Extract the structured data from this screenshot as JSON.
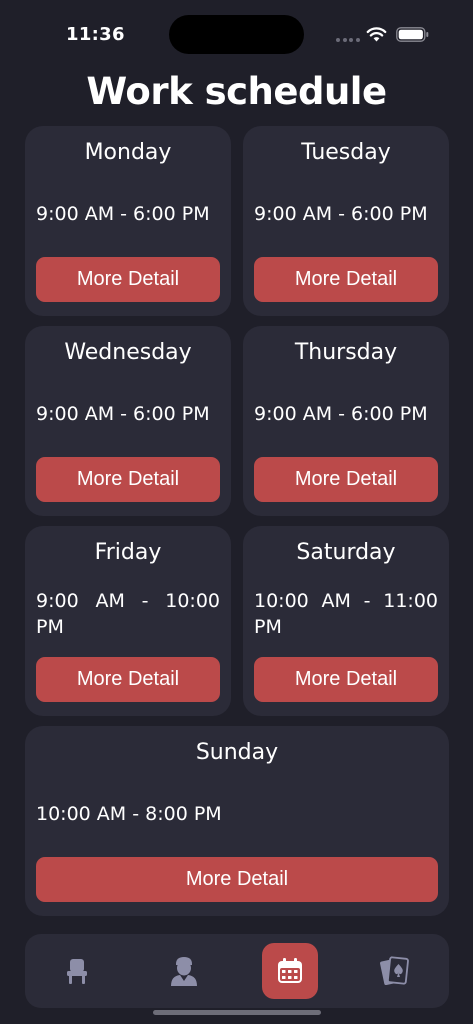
{
  "status_bar": {
    "time": "11:36"
  },
  "title": "Work schedule",
  "days": [
    {
      "name": "Monday",
      "hours": "9:00 AM - 6:00 PM",
      "button": "More Detail"
    },
    {
      "name": "Tuesday",
      "hours": "9:00 AM - 6:00 PM",
      "button": "More Detail"
    },
    {
      "name": "Wednesday",
      "hours": "9:00 AM - 6:00 PM",
      "button": "More Detail"
    },
    {
      "name": "Thursday",
      "hours": "9:00 AM - 6:00 PM",
      "button": "More Detail"
    },
    {
      "name": "Friday",
      "hours": "9:00 AM - 10:00 PM",
      "button": "More Detail"
    },
    {
      "name": "Saturday",
      "hours": "10:00 AM - 11:00 PM",
      "button": "More Detail"
    },
    {
      "name": "Sunday",
      "hours": "10:00 AM - 8:00 PM",
      "button": "More Detail"
    }
  ],
  "tab_bar": {
    "tabs": [
      {
        "icon": "chair-icon",
        "active": false
      },
      {
        "icon": "user-icon",
        "active": false
      },
      {
        "icon": "calendar-icon",
        "active": true
      },
      {
        "icon": "playing-cards-icon",
        "active": false
      }
    ]
  },
  "colors": {
    "background": "#1f1f29",
    "card": "#2b2b38",
    "accent": "#bb4a4a",
    "icon_inactive": "#8d8ea8"
  }
}
